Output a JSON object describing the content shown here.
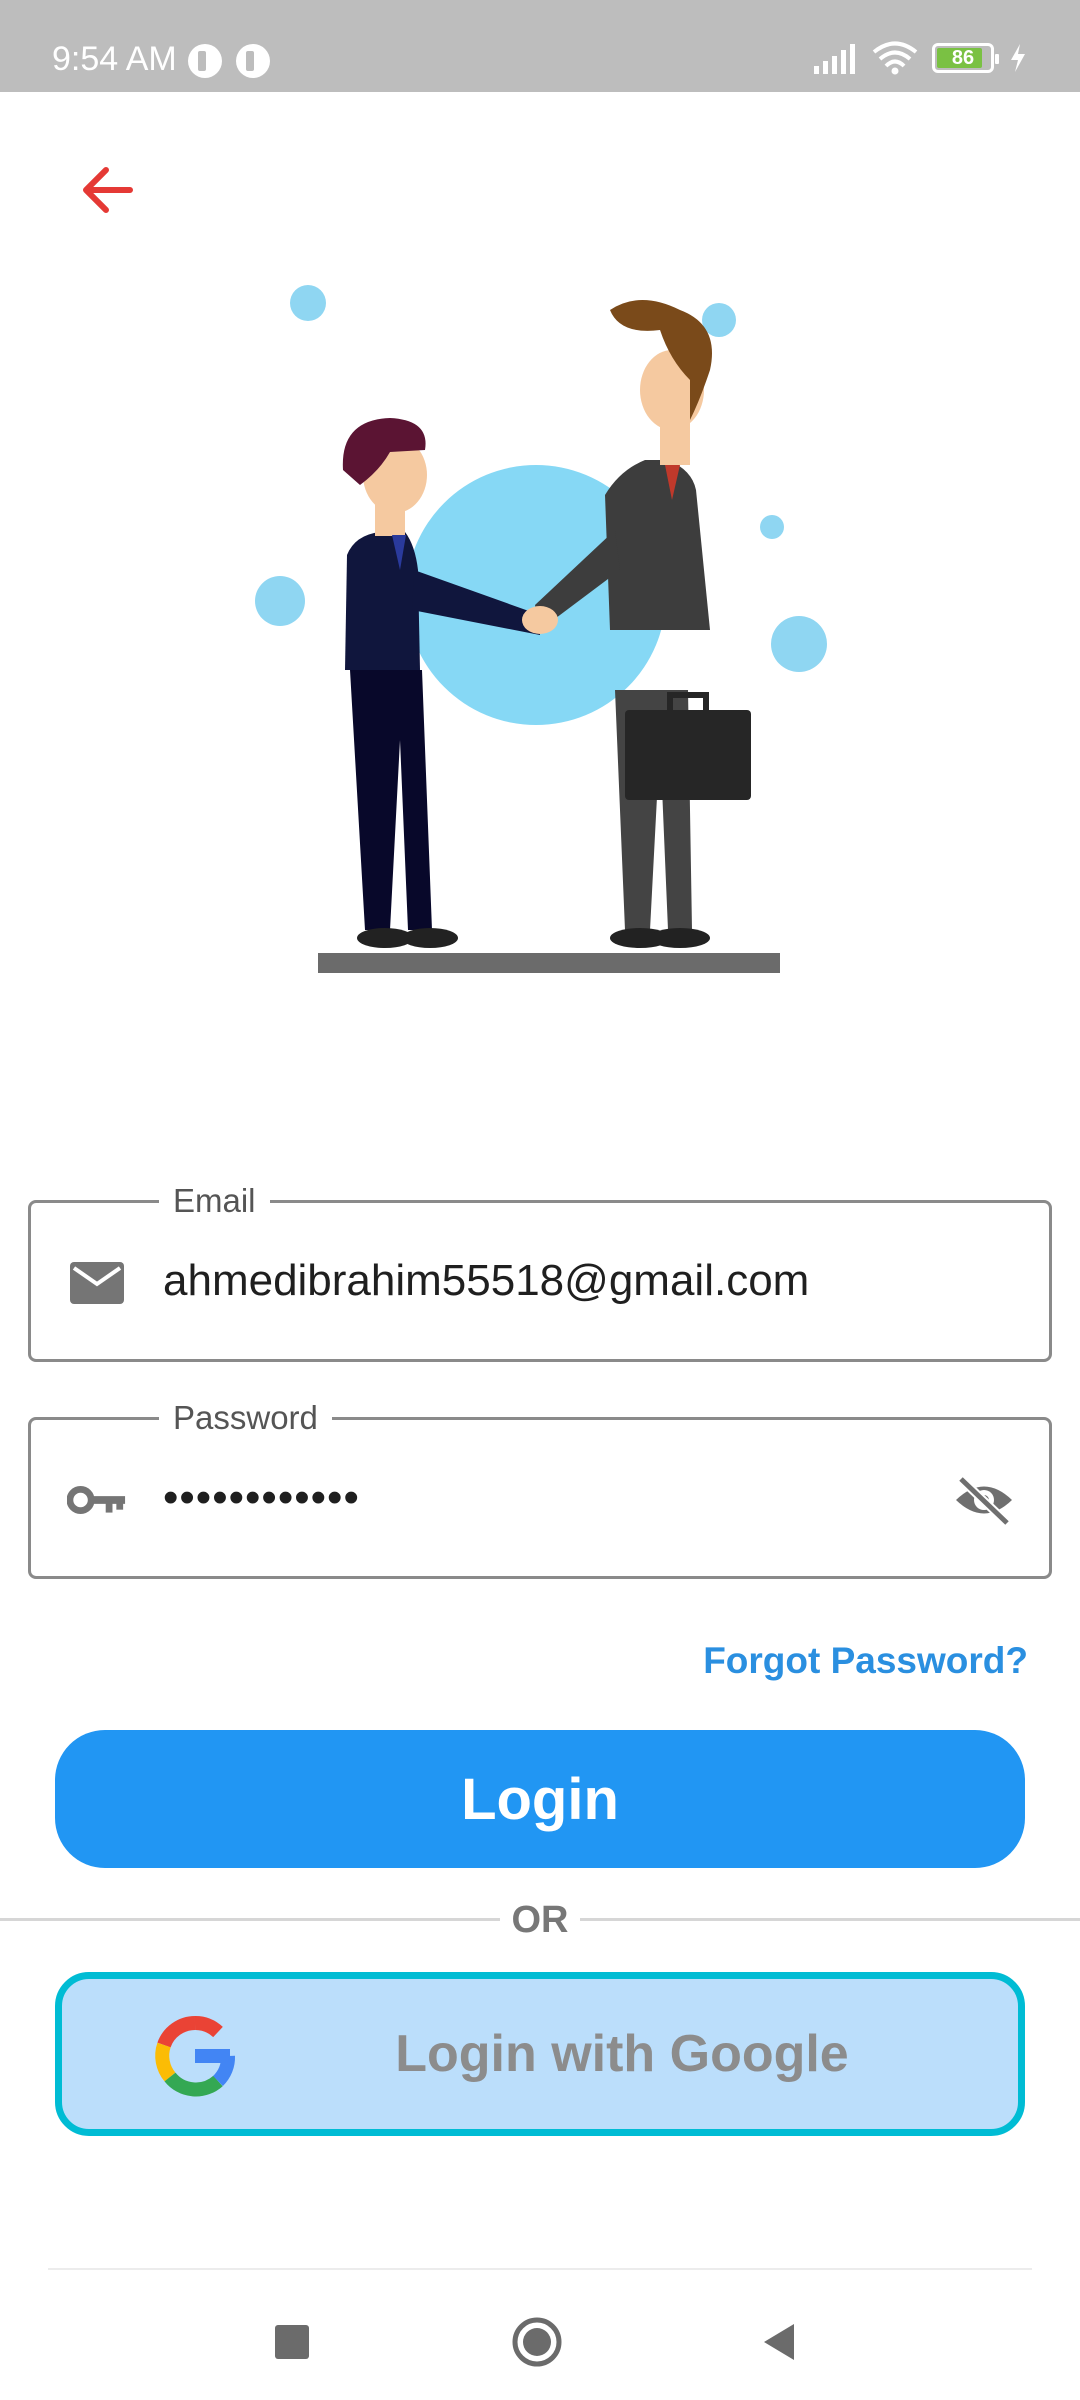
{
  "status_bar": {
    "time": "9:54 AM",
    "battery_level": "86",
    "battery_fraction": 0.86,
    "icons": [
      "notification-icon",
      "notification-icon",
      "signal-icon",
      "wifi-icon",
      "battery-icon",
      "charging-icon"
    ]
  },
  "header": {
    "back_icon": "arrow-left-icon",
    "back_color": "#e53935"
  },
  "illustration": {
    "subject": "handshake-illustration"
  },
  "email_field": {
    "label": "Email",
    "value": "ahmedibrahim55518@gmail.com",
    "icon": "mail-icon"
  },
  "password_field": {
    "label": "Password",
    "value": "••••••••••••",
    "icon": "key-icon",
    "toggle_icon": "eye-off-icon"
  },
  "forgot_password": {
    "label": "Forgot Password?"
  },
  "login_button": {
    "label": "Login"
  },
  "divider": {
    "label": "OR"
  },
  "google_button": {
    "label": "Login with Google",
    "icon": "google-logo-icon"
  },
  "colors": {
    "primary": "#2196f3",
    "link": "#2a8fe0",
    "google_bg": "#bbdefb",
    "google_border": "#00bcd4",
    "status_bar": "#bdbdbd"
  },
  "nav_bar": {
    "buttons": [
      "recents-button",
      "home-button",
      "back-nav-button"
    ]
  }
}
